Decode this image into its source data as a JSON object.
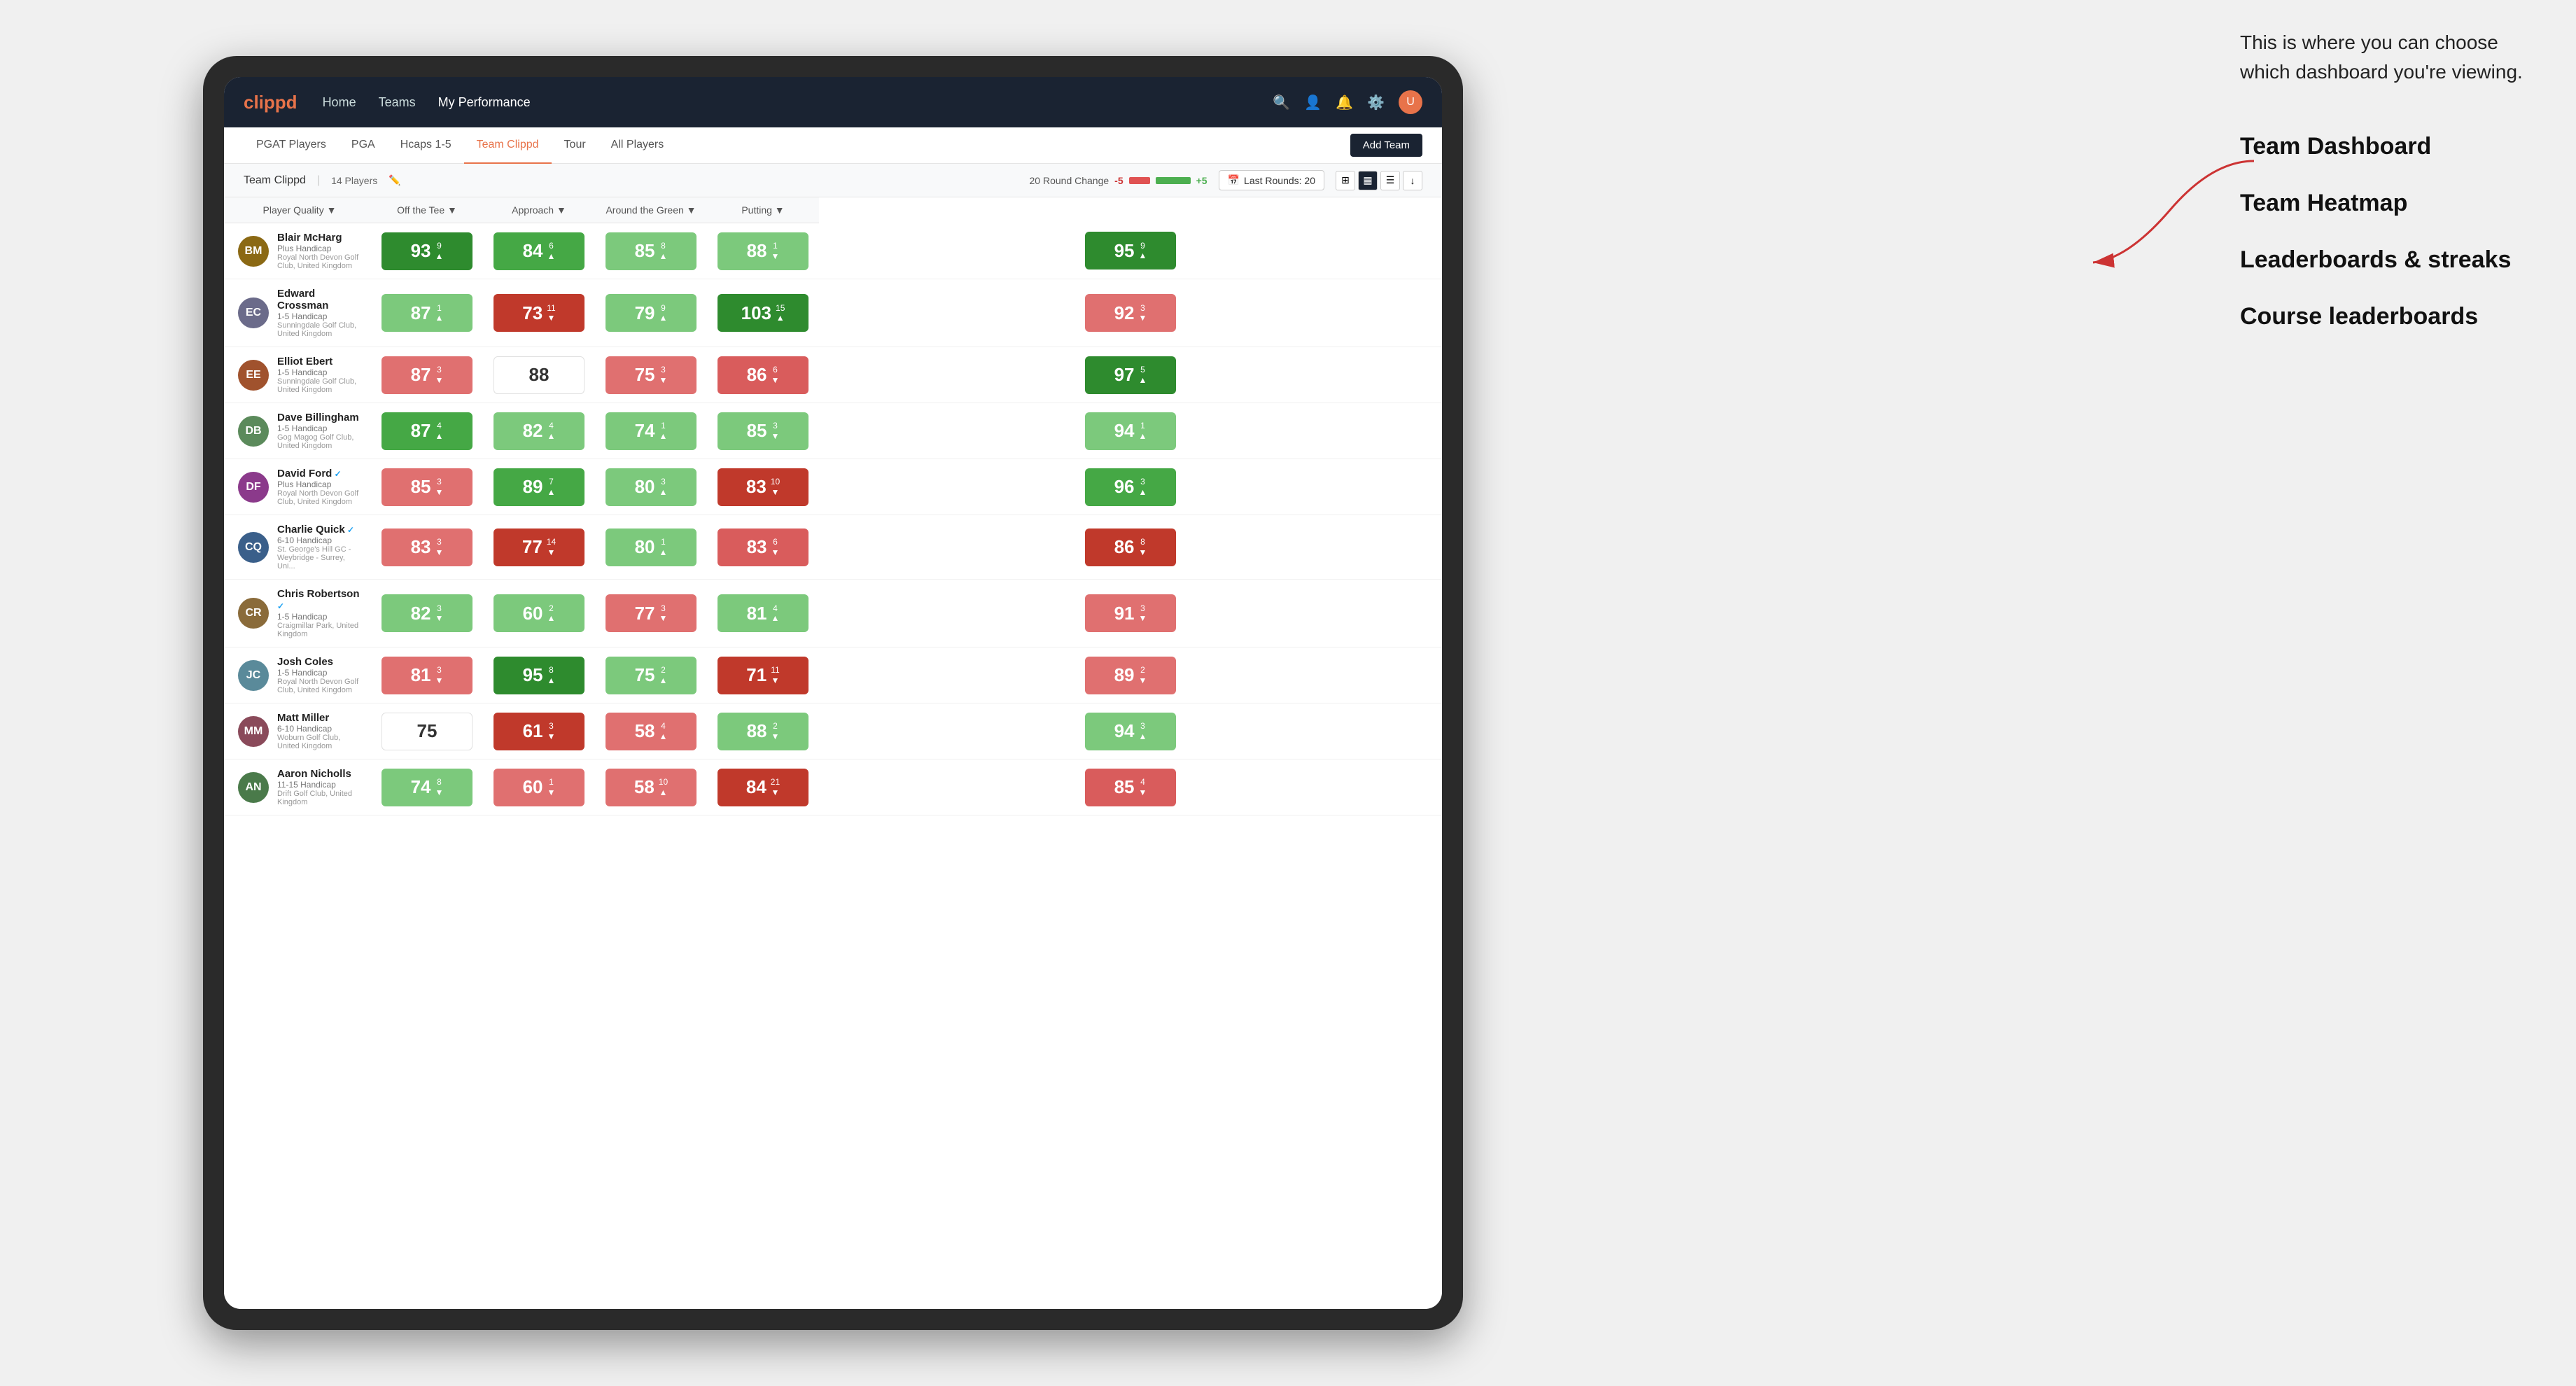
{
  "annotation": {
    "intro": "This is where you can choose which dashboard you're viewing.",
    "options": [
      "Team Dashboard",
      "Team Heatmap",
      "Leaderboards & streaks",
      "Course leaderboards"
    ]
  },
  "nav": {
    "logo": "clippd",
    "links": [
      "Home",
      "Teams",
      "My Performance"
    ],
    "active_link": "My Performance"
  },
  "secondary_nav": {
    "links": [
      "PGAT Players",
      "PGA",
      "Hcaps 1-5",
      "Team Clippd",
      "Tour",
      "All Players"
    ],
    "active_link": "Team Clippd",
    "add_team_label": "Add Team"
  },
  "team_bar": {
    "team_name": "Team Clippd",
    "separator": "|",
    "player_count": "14 Players",
    "round_change_label": "20 Round Change",
    "change_neg": "-5",
    "change_pos": "+5",
    "last_rounds_label": "Last Rounds:",
    "last_rounds_value": "20"
  },
  "table": {
    "columns": [
      "Player Quality ↓",
      "Off the Tee ↓",
      "Approach ↓",
      "Around the Green ↓",
      "Putting ↓"
    ],
    "rows": [
      {
        "name": "Blair McHarg",
        "handicap": "Plus Handicap",
        "club": "Royal North Devon Golf Club, United Kingdom",
        "avatar_color": "#8B6914",
        "scores": [
          {
            "value": 93,
            "change": "+9",
            "dir": "up",
            "color": "green-dark"
          },
          {
            "value": 84,
            "change": "6",
            "dir": "up",
            "color": "green-medium"
          },
          {
            "value": 85,
            "change": "8",
            "dir": "up",
            "color": "green-light"
          },
          {
            "value": 88,
            "change": "-1",
            "dir": "down",
            "color": "green-light"
          },
          {
            "value": 95,
            "change": "9",
            "dir": "up",
            "color": "green-dark"
          }
        ]
      },
      {
        "name": "Edward Crossman",
        "handicap": "1-5 Handicap",
        "club": "Sunningdale Golf Club, United Kingdom",
        "avatar_color": "#6B6B8A",
        "scores": [
          {
            "value": 87,
            "change": "1",
            "dir": "up",
            "color": "green-light"
          },
          {
            "value": 73,
            "change": "-11",
            "dir": "down",
            "color": "red-dark"
          },
          {
            "value": 79,
            "change": "9",
            "dir": "up",
            "color": "green-light"
          },
          {
            "value": 103,
            "change": "15",
            "dir": "up",
            "color": "green-dark"
          },
          {
            "value": 92,
            "change": "-3",
            "dir": "down",
            "color": "red-light"
          }
        ]
      },
      {
        "name": "Elliot Ebert",
        "handicap": "1-5 Handicap",
        "club": "Sunningdale Golf Club, United Kingdom",
        "avatar_color": "#A0522D",
        "scores": [
          {
            "value": 87,
            "change": "-3",
            "dir": "down",
            "color": "red-light"
          },
          {
            "value": 88,
            "change": "",
            "dir": "none",
            "color": "white-bg"
          },
          {
            "value": 75,
            "change": "-3",
            "dir": "down",
            "color": "red-light"
          },
          {
            "value": 86,
            "change": "-6",
            "dir": "down",
            "color": "red-medium"
          },
          {
            "value": 97,
            "change": "5",
            "dir": "up",
            "color": "green-dark"
          }
        ]
      },
      {
        "name": "Dave Billingham",
        "handicap": "1-5 Handicap",
        "club": "Gog Magog Golf Club, United Kingdom",
        "avatar_color": "#5B8A5B",
        "scores": [
          {
            "value": 87,
            "change": "4",
            "dir": "up",
            "color": "green-medium"
          },
          {
            "value": 82,
            "change": "4",
            "dir": "up",
            "color": "green-light"
          },
          {
            "value": 74,
            "change": "1",
            "dir": "up",
            "color": "green-light"
          },
          {
            "value": 85,
            "change": "-3",
            "dir": "down",
            "color": "green-light"
          },
          {
            "value": 94,
            "change": "1",
            "dir": "up",
            "color": "green-light"
          }
        ]
      },
      {
        "name": "David Ford",
        "handicap": "Plus Handicap",
        "club": "Royal North Devon Golf Club, United Kingdom",
        "avatar_color": "#8B3A8B",
        "verified": true,
        "scores": [
          {
            "value": 85,
            "change": "-3",
            "dir": "down",
            "color": "red-light"
          },
          {
            "value": 89,
            "change": "7",
            "dir": "up",
            "color": "green-medium"
          },
          {
            "value": 80,
            "change": "3",
            "dir": "up",
            "color": "green-light"
          },
          {
            "value": 83,
            "change": "-10",
            "dir": "down",
            "color": "red-dark"
          },
          {
            "value": 96,
            "change": "3",
            "dir": "up",
            "color": "green-medium"
          }
        ]
      },
      {
        "name": "Charlie Quick",
        "handicap": "6-10 Handicap",
        "club": "St. George's Hill GC - Weybridge - Surrey, Uni...",
        "avatar_color": "#3A5F8A",
        "verified": true,
        "scores": [
          {
            "value": 83,
            "change": "-3",
            "dir": "down",
            "color": "red-light"
          },
          {
            "value": 77,
            "change": "-14",
            "dir": "down",
            "color": "red-dark"
          },
          {
            "value": 80,
            "change": "1",
            "dir": "up",
            "color": "green-light"
          },
          {
            "value": 83,
            "change": "-6",
            "dir": "down",
            "color": "red-medium"
          },
          {
            "value": 86,
            "change": "-8",
            "dir": "down",
            "color": "red-dark"
          }
        ]
      },
      {
        "name": "Chris Robertson",
        "handicap": "1-5 Handicap",
        "club": "Craigmillar Park, United Kingdom",
        "avatar_color": "#8A6B3A",
        "verified": true,
        "scores": [
          {
            "value": 82,
            "change": "-3",
            "dir": "down",
            "color": "green-light"
          },
          {
            "value": 60,
            "change": "2",
            "dir": "up",
            "color": "green-light"
          },
          {
            "value": 77,
            "change": "-3",
            "dir": "down",
            "color": "red-light"
          },
          {
            "value": 81,
            "change": "4",
            "dir": "up",
            "color": "green-light"
          },
          {
            "value": 91,
            "change": "-3",
            "dir": "down",
            "color": "red-light"
          }
        ]
      },
      {
        "name": "Josh Coles",
        "handicap": "1-5 Handicap",
        "club": "Royal North Devon Golf Club, United Kingdom",
        "avatar_color": "#5A8A9A",
        "scores": [
          {
            "value": 81,
            "change": "-3",
            "dir": "down",
            "color": "red-light"
          },
          {
            "value": 95,
            "change": "8",
            "dir": "up",
            "color": "green-dark"
          },
          {
            "value": 75,
            "change": "2",
            "dir": "up",
            "color": "green-light"
          },
          {
            "value": 71,
            "change": "-11",
            "dir": "down",
            "color": "red-dark"
          },
          {
            "value": 89,
            "change": "-2",
            "dir": "down",
            "color": "red-light"
          }
        ]
      },
      {
        "name": "Matt Miller",
        "handicap": "6-10 Handicap",
        "club": "Woburn Golf Club, United Kingdom",
        "avatar_color": "#8A4A5A",
        "scores": [
          {
            "value": 75,
            "change": "",
            "dir": "none",
            "color": "white-bg"
          },
          {
            "value": 61,
            "change": "-3",
            "dir": "down",
            "color": "red-dark"
          },
          {
            "value": 58,
            "change": "4",
            "dir": "up",
            "color": "red-light"
          },
          {
            "value": 88,
            "change": "-2",
            "dir": "down",
            "color": "green-light"
          },
          {
            "value": 94,
            "change": "3",
            "dir": "up",
            "color": "green-light"
          }
        ]
      },
      {
        "name": "Aaron Nicholls",
        "handicap": "11-15 Handicap",
        "club": "Drift Golf Club, United Kingdom",
        "avatar_color": "#4A7A4A",
        "scores": [
          {
            "value": 74,
            "change": "-8",
            "dir": "down",
            "color": "green-light"
          },
          {
            "value": 60,
            "change": "-1",
            "dir": "down",
            "color": "red-light"
          },
          {
            "value": 58,
            "change": "10",
            "dir": "up",
            "color": "red-light"
          },
          {
            "value": 84,
            "change": "-21",
            "dir": "down",
            "color": "red-dark"
          },
          {
            "value": 85,
            "change": "-4",
            "dir": "down",
            "color": "red-medium"
          }
        ]
      }
    ]
  }
}
